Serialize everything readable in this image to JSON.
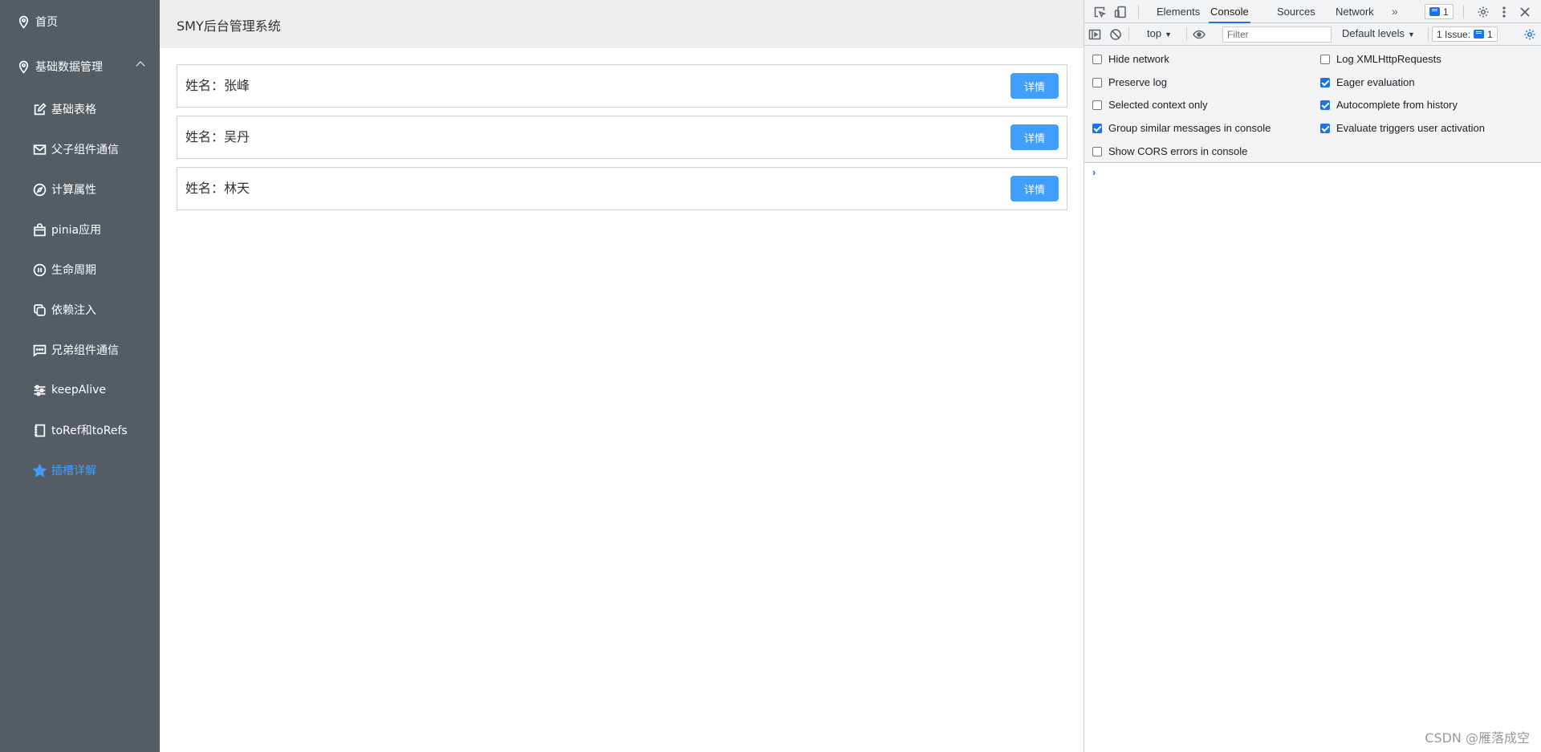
{
  "sidebar": {
    "items": [
      {
        "label": "首页",
        "icon": "location-icon"
      },
      {
        "label": "基础数据管理",
        "icon": "location-icon"
      },
      {
        "label": "基础表格",
        "icon": "edit-icon"
      },
      {
        "label": "父子组件通信",
        "icon": "message-icon"
      },
      {
        "label": "计算属性",
        "icon": "compass-icon"
      },
      {
        "label": "pinia应用",
        "icon": "shopping-bag-icon"
      },
      {
        "label": "生命周期",
        "icon": "pause-circle-icon"
      },
      {
        "label": "依赖注入",
        "icon": "copy-icon"
      },
      {
        "label": "兄弟组件通信",
        "icon": "chat-dots-icon"
      },
      {
        "label": "keepAlive",
        "icon": "operation-icon"
      },
      {
        "label": "toRef和toRefs",
        "icon": "notebook-icon"
      },
      {
        "label": "插槽详解",
        "icon": "star-icon"
      }
    ],
    "active_color": "#409eff",
    "background": "#545c64"
  },
  "header": {
    "title": "SMY后台管理系统"
  },
  "cards": [
    {
      "name": "姓名：张峰",
      "button": "详情"
    },
    {
      "name": "姓名：吴丹",
      "button": "详情"
    },
    {
      "name": "姓名：林天",
      "button": "详情"
    }
  ],
  "devtools": {
    "tabs": [
      "Elements",
      "Console",
      "Sources",
      "Network"
    ],
    "active_tab": "Console",
    "messages_count": "1",
    "toolbar": {
      "context": "top",
      "filter_placeholder": "Filter",
      "levels": "Default levels",
      "issues": "1 Issue:",
      "issues_count": "1"
    },
    "settings_left": [
      {
        "label": "Hide network",
        "checked": false
      },
      {
        "label": "Preserve log",
        "checked": false
      },
      {
        "label": "Selected context only",
        "checked": false
      },
      {
        "label": "Group similar messages in console",
        "checked": true
      },
      {
        "label": "Show CORS errors in console",
        "checked": false
      }
    ],
    "settings_right": [
      {
        "label": "Log XMLHttpRequests",
        "checked": false
      },
      {
        "label": "Eager evaluation",
        "checked": true
      },
      {
        "label": "Autocomplete from history",
        "checked": true
      },
      {
        "label": "Evaluate triggers user activation",
        "checked": true
      }
    ],
    "prompt": "›"
  },
  "watermark": "CSDN @雁落成空"
}
